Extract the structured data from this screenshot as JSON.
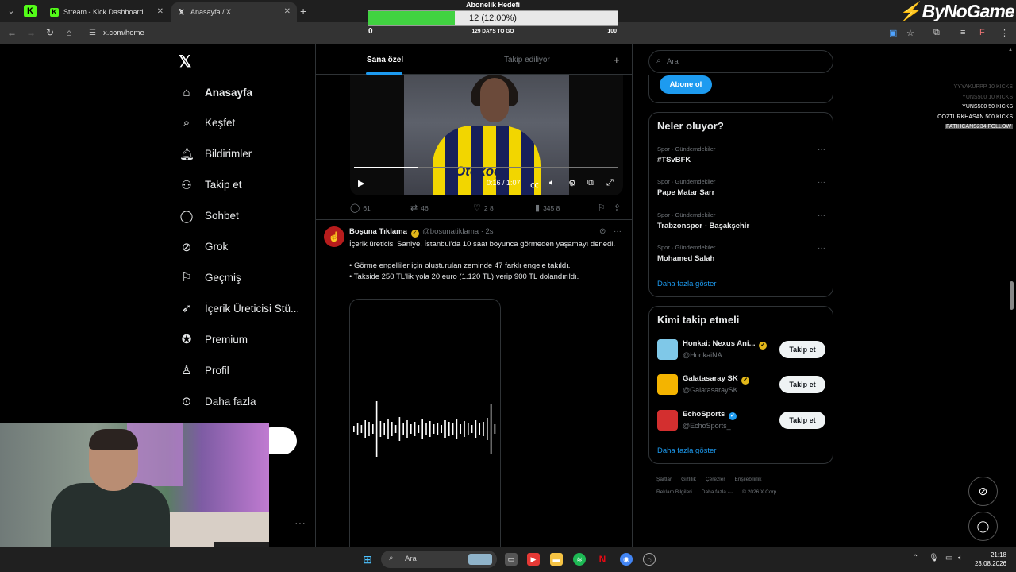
{
  "browser": {
    "tabs": [
      {
        "label": "Stream - Kick Dashboard",
        "icon": "kick-icon"
      },
      {
        "label": "Anasayfa / X",
        "icon": "x-icon"
      }
    ],
    "url": "x.com/home"
  },
  "overlay": {
    "goal_title": "Abonelik Hedefi",
    "goal_value": "12 (12.00%)",
    "goal_progress": 0.12,
    "goal_min": "0",
    "goal_max": "100",
    "goal_days": "129 DAYS TO GO",
    "brand": "ByNoGame",
    "events": [
      {
        "user": "YYYAKUPPP",
        "detail": "10 KICKS",
        "style": "dim"
      },
      {
        "user": "YUNS500",
        "detail": "10 KICKS",
        "style": "dim"
      },
      {
        "user": "YUNS500",
        "detail": "50 KICKS",
        "style": "normal"
      },
      {
        "user": "OOZTURKHASAN",
        "detail": "500 KICKS",
        "style": "normal"
      },
      {
        "user": "FATIHCANS234",
        "detail": "FOLLOW",
        "style": "highlight"
      }
    ]
  },
  "nav": {
    "items": [
      {
        "label": "Anasayfa",
        "icon": "home-icon",
        "active": true
      },
      {
        "label": "Keşfet",
        "icon": "search-icon"
      },
      {
        "label": "Bildirimler",
        "icon": "bell-icon"
      },
      {
        "label": "Takip et",
        "icon": "person-add-icon"
      },
      {
        "label": "Sohbet",
        "icon": "chat-icon"
      },
      {
        "label": "Grok",
        "icon": "grok-icon"
      },
      {
        "label": "Geçmiş",
        "icon": "bookmark-icon"
      },
      {
        "label": "İçerik Üreticisi Stü...",
        "icon": "rocket-icon"
      },
      {
        "label": "Premium",
        "icon": "verified-badge-icon"
      },
      {
        "label": "Profil",
        "icon": "profile-icon"
      },
      {
        "label": "Daha fazla",
        "icon": "more-circle-icon"
      }
    ]
  },
  "feed": {
    "tab_for_you": "Sana özel",
    "tab_following": "Takip ediliyor",
    "video": {
      "jersey_text": "Otokoç",
      "time": "0:16 / 1:07",
      "progress": 0.24
    },
    "prev_actions": {
      "replies": "61",
      "reposts": "46",
      "likes": "2 8",
      "views": "345 8"
    },
    "tweet": {
      "name": "Boşuna Tıklama",
      "handle": "@bosunatiklama",
      "time": "2s",
      "lines": [
        "İçerik üreticisi Saniye, İstanbul'da 10 saat boyunca görmeden yaşamayı denedi.",
        "",
        "• Görme engelliler için oluşturulan zeminde 47 farklı engele takıldı.",
        "• Takside 250 TL'lik yola 20 euro (1.120 TL) verip 900 TL dolandırıldı."
      ]
    }
  },
  "right": {
    "search_placeholder": "Ara",
    "subscribe_label": "Abone ol",
    "trends_title": "Neler oluyor?",
    "trends": [
      {
        "category": "Spor · Gündemdekiler",
        "name": "#TSvBFK"
      },
      {
        "category": "Spor · Gündemdekiler",
        "name": "Pape Matar Sarr"
      },
      {
        "category": "Spor · Gündemdekiler",
        "name": "Trabzonspor - Başakşehir"
      },
      {
        "category": "Spor · Gündemdekiler",
        "name": "Mohamed Salah"
      }
    ],
    "show_more": "Daha fazla göster",
    "who_title": "Kimi takip etmeli",
    "who": [
      {
        "name": "Honkai: Nexus Ani...",
        "handle": "@HonkaiNA",
        "badge": "gold",
        "color": "#7fc8e8"
      },
      {
        "name": "Galatasaray SK",
        "handle": "@GalatasaraySK",
        "badge": "gold",
        "color": "#f4b400"
      },
      {
        "name": "EchoSports",
        "handle": "@EchoSports_",
        "badge": "blue",
        "color": "#d32f2f"
      }
    ],
    "follow_label": "Takip et",
    "footer_row1": [
      "Şartlar",
      "Gizlilik",
      "Çerezler",
      "Erişilebilirlik"
    ],
    "footer_row2": [
      "Reklam Bilgileri",
      "Daha fazla ···",
      "© 2026 X Corp."
    ]
  },
  "taskbar": {
    "search_label": "Ara",
    "time": "21:18",
    "date": "23.08.2026"
  },
  "colors": {
    "accent": "#1d9bf0",
    "goal_fill": "#41d341",
    "kick_green": "#53fc18"
  }
}
